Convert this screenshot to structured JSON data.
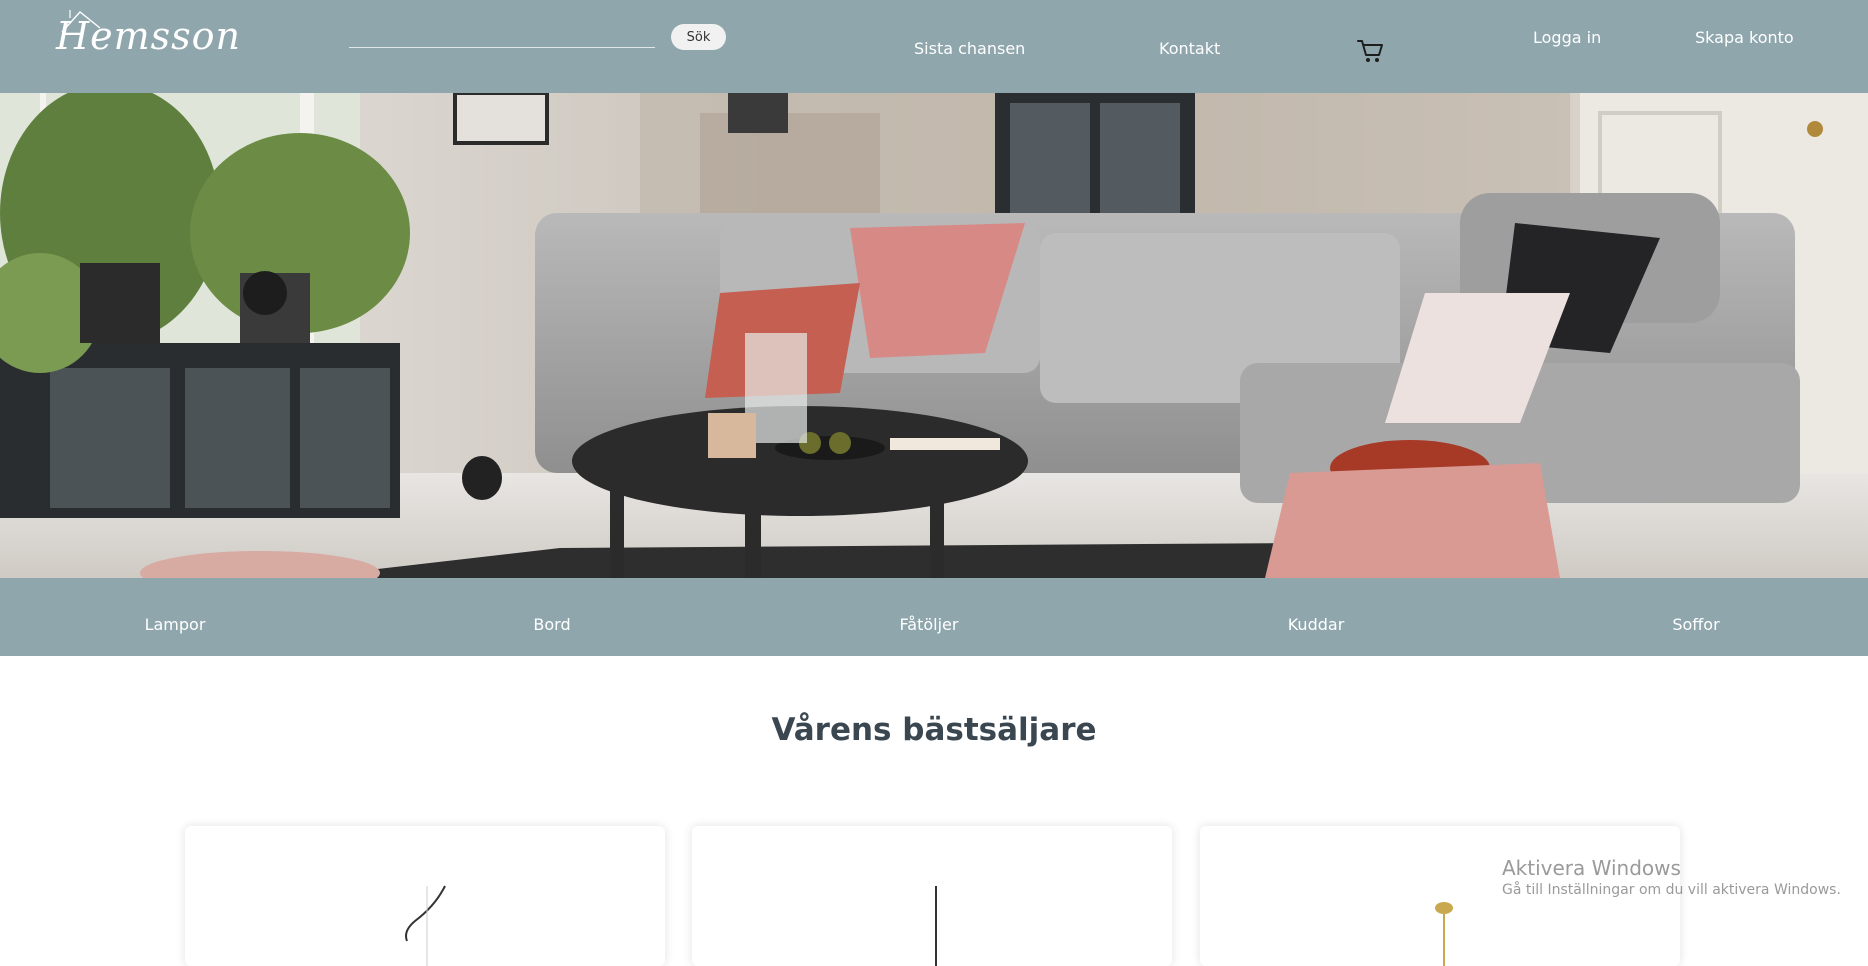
{
  "header": {
    "logo_text": "Hemsson",
    "search": {
      "placeholder": "",
      "value": "",
      "button_label": "Sök"
    },
    "nav": {
      "sista_chansen": "Sista chansen",
      "kontakt": "Kontakt",
      "cart_icon": "shopping-cart-icon",
      "logga_in": "Logga in",
      "skapa_konto": "Skapa konto"
    }
  },
  "categories": [
    "Lampor",
    "Bord",
    "Fåtöljer",
    "Kuddar",
    "Soffor"
  ],
  "section": {
    "title": "Vårens bästsäljare"
  },
  "system_overlay": {
    "title": "Aktivera Windows",
    "subtitle": "Gå till Inställningar om du vill aktivera Windows."
  },
  "colors": {
    "header_bg": "#8fa6ad",
    "text_light": "#ffffff",
    "title_dark": "#3a4750"
  }
}
